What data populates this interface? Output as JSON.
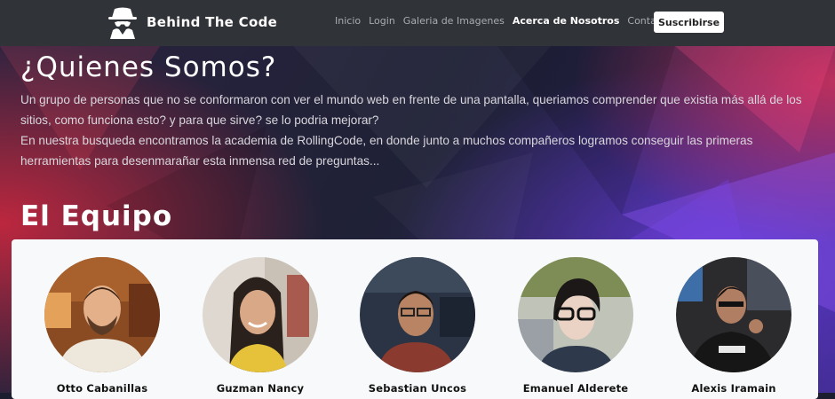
{
  "brand": {
    "name": "Behind The Code",
    "icon": "spy-icon"
  },
  "nav": {
    "items": [
      {
        "label": "Inicio",
        "active": false
      },
      {
        "label": "Login",
        "active": false
      },
      {
        "label": "Galeria de Imagenes",
        "active": false
      },
      {
        "label": "Acerca de Nosotros",
        "active": true
      },
      {
        "label": "Contacto",
        "active": false
      }
    ],
    "subscribe_label": "Suscribirse"
  },
  "about": {
    "title": "¿Quienes Somos?",
    "paragraph1": "Un grupo de personas que no se conformaron con ver el mundo web en frente de una pantalla, queriamos comprender que existia más allá de los sitios, como funciona esto? y para que sirve? se lo podria mejorar?",
    "paragraph2": "En nuestra busqueda encontramos la academia de RollingCode, en donde junto a muchos compañeros logramos conseguir las primeras herramientas para desenmarañar esta inmensa red de preguntas..."
  },
  "team": {
    "title": "El Equipo",
    "members": [
      {
        "name": "Otto Cabanillas"
      },
      {
        "name": "Guzman Nancy"
      },
      {
        "name": "Sebastian Uncos"
      },
      {
        "name": "Emanuel Alderete"
      },
      {
        "name": "Alexis Iramain"
      }
    ]
  }
}
